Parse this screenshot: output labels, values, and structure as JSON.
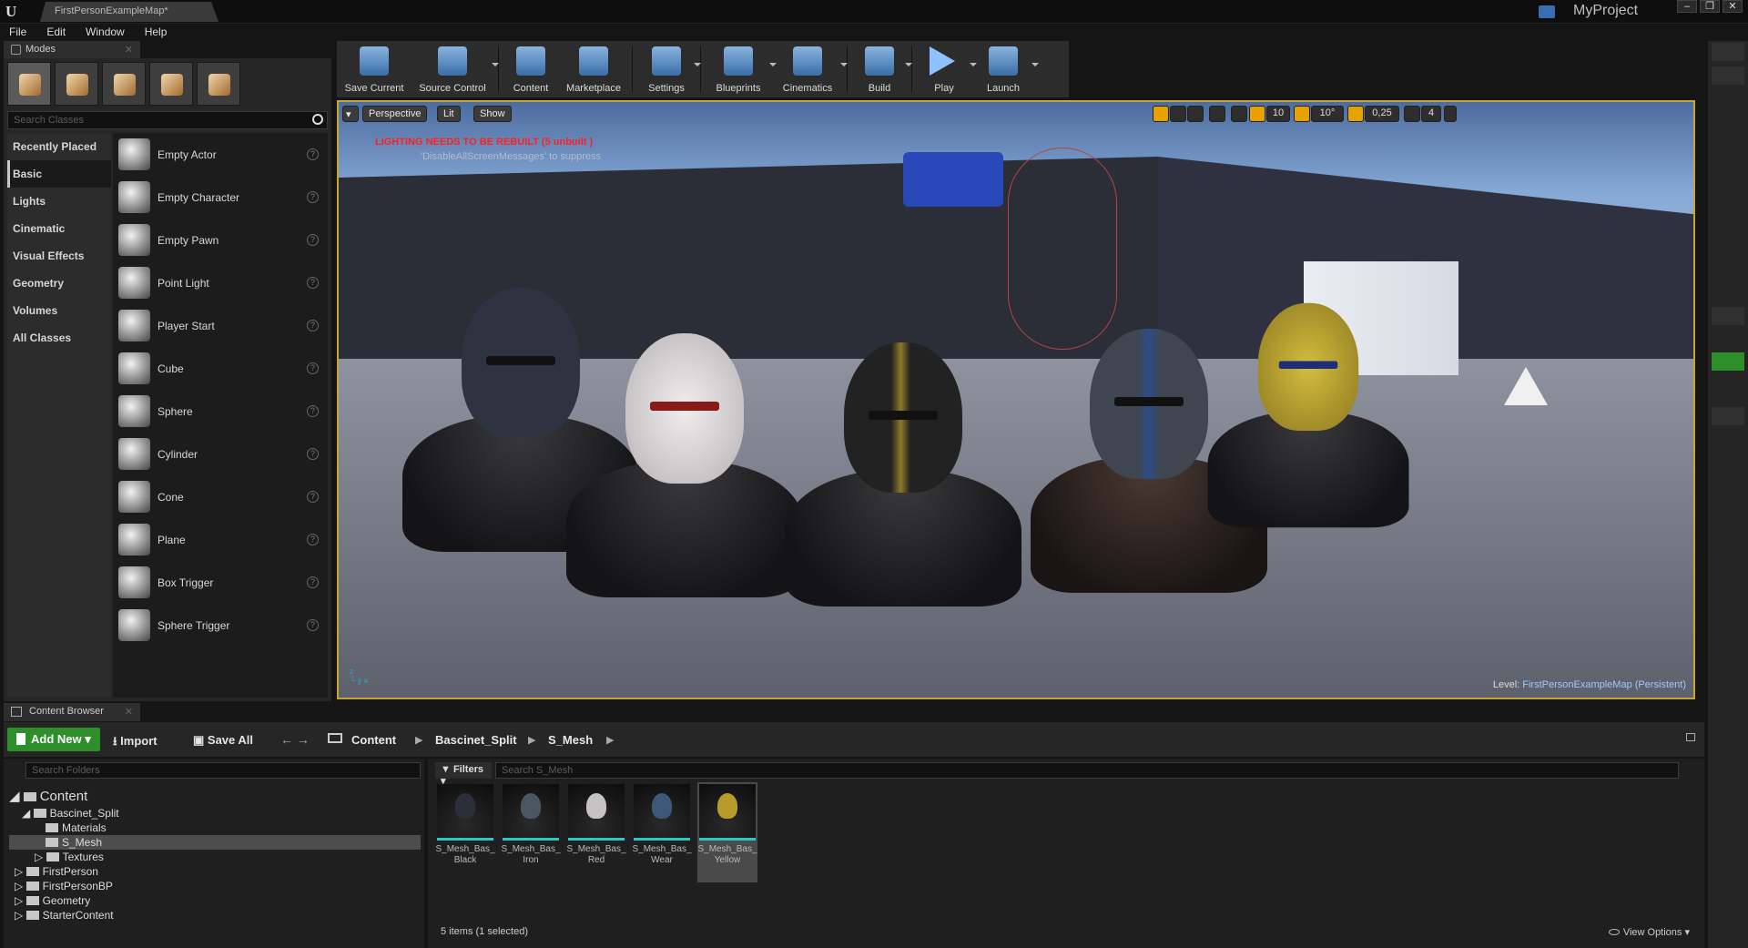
{
  "window": {
    "tab_title": "FirstPersonExampleMap*",
    "project_name": "MyProject",
    "buttons": [
      "–",
      "❐",
      "✕"
    ]
  },
  "menu": [
    "File",
    "Edit",
    "Window",
    "Help"
  ],
  "modes": {
    "tab_label": "Modes",
    "search_placeholder": "Search Classes",
    "categories": [
      "Recently Placed",
      "Basic",
      "Lights",
      "Cinematic",
      "Visual Effects",
      "Geometry",
      "Volumes",
      "All Classes"
    ],
    "selected_category": "Basic",
    "items": [
      "Empty Actor",
      "Empty Character",
      "Empty Pawn",
      "Point Light",
      "Player Start",
      "Cube",
      "Sphere",
      "Cylinder",
      "Cone",
      "Plane",
      "Box Trigger",
      "Sphere Trigger"
    ],
    "help_glyph": "?"
  },
  "toolbar": {
    "buttons": [
      {
        "label": "Save Current",
        "icon": "save-icon"
      },
      {
        "label": "Source Control",
        "icon": "source-control-icon"
      },
      {
        "label": "Content",
        "icon": "content-icon"
      },
      {
        "label": "Marketplace",
        "icon": "marketplace-icon"
      },
      {
        "label": "Settings",
        "icon": "settings-icon"
      },
      {
        "label": "Blueprints",
        "icon": "blueprints-icon"
      },
      {
        "label": "Cinematics",
        "icon": "cinematics-icon"
      },
      {
        "label": "Build",
        "icon": "build-icon"
      },
      {
        "label": "Play",
        "icon": "play-icon"
      },
      {
        "label": "Launch",
        "icon": "launch-icon"
      }
    ]
  },
  "viewport": {
    "perspective": "Perspective",
    "lit": "Lit",
    "show": "Show",
    "grid_snap": "10",
    "rot_snap": "10°",
    "scale_snap": "0,25",
    "cam_speed": "4",
    "warning": "LIGHTING NEEDS TO BE REBUILT (5 unbuilt )",
    "warning_sub": "'DisableAllScreenMessages' to suppress",
    "level_prefix": "Level:",
    "level_name": "FirstPersonExampleMap (Persistent)"
  },
  "content_browser": {
    "tab_label": "Content Browser",
    "add_new": "Add New",
    "import": "Import",
    "save_all": "Save All",
    "breadcrumbs": [
      "Content",
      "Bascinet_Split",
      "S_Mesh"
    ],
    "folder_search_placeholder": "Search Folders",
    "filters": "Filters",
    "asset_search_placeholder": "Search S_Mesh",
    "tree": [
      {
        "label": "Content",
        "depth": 0,
        "expanded": true
      },
      {
        "label": "Bascinet_Split",
        "depth": 1,
        "expanded": true
      },
      {
        "label": "Materials",
        "depth": 2
      },
      {
        "label": "S_Mesh",
        "depth": 2,
        "selected": true
      },
      {
        "label": "Textures",
        "depth": 2
      },
      {
        "label": "FirstPerson",
        "depth": 1
      },
      {
        "label": "FirstPersonBP",
        "depth": 1
      },
      {
        "label": "Geometry",
        "depth": 1
      },
      {
        "label": "StarterContent",
        "depth": 1
      }
    ],
    "assets": [
      {
        "line1": "S_Mesh_Bas_",
        "line2": "Black",
        "color": "#2a2f3a"
      },
      {
        "line1": "S_Mesh_Bas_",
        "line2": "Iron",
        "color": "#4b5663"
      },
      {
        "line1": "S_Mesh_Bas_",
        "line2": "Red",
        "color": "#c7c2c4"
      },
      {
        "line1": "S_Mesh_Bas_",
        "line2": "Wear",
        "color": "#3d5878"
      },
      {
        "line1": "S_Mesh_Bas_",
        "line2": "Yellow",
        "color": "#b79c2c"
      }
    ],
    "selected_asset": 4,
    "status": "5 items (1 selected)",
    "view_options": "View Options"
  }
}
